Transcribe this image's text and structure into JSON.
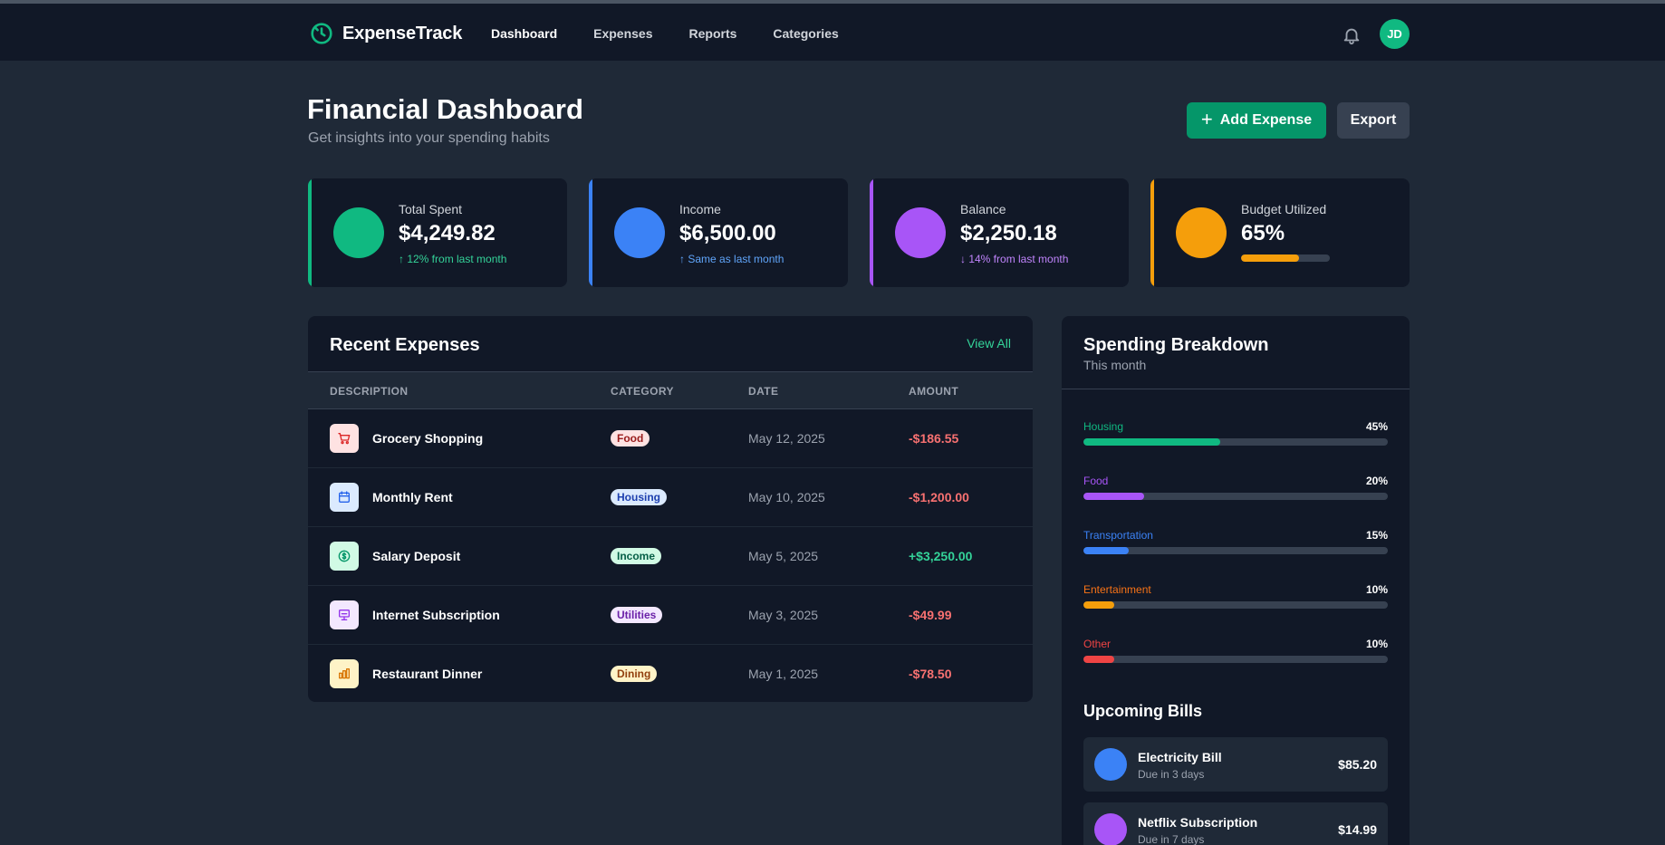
{
  "nav": {
    "brand": "ExpenseTrack",
    "links": [
      "Dashboard",
      "Expenses",
      "Reports",
      "Categories"
    ],
    "active": "Dashboard",
    "avatar_initials": "JD"
  },
  "header": {
    "title": "Financial Dashboard",
    "subtitle": "Get insights into your spending habits",
    "add_label": "Add Expense",
    "export_label": "Export"
  },
  "stats": [
    {
      "label": "Total Spent",
      "value": "$4,249.82",
      "change": "↑ 12% from last month",
      "color": "#10b981",
      "change_color": "#34d399"
    },
    {
      "label": "Income",
      "value": "$6,500.00",
      "change": "↑ Same as last month",
      "color": "#3b82f6",
      "change_color": "#60a5fa"
    },
    {
      "label": "Balance",
      "value": "$2,250.18",
      "change": "↓ 14% from last month",
      "color": "#a855f7",
      "change_color": "#c084fc"
    },
    {
      "label": "Budget Utilized",
      "value": "65%",
      "progress": 0.65,
      "color": "#f59e0b"
    }
  ],
  "recent": {
    "title": "Recent Expenses",
    "view_all": "View All",
    "columns": [
      "DESCRIPTION",
      "CATEGORY",
      "DATE",
      "AMOUNT"
    ],
    "rows": [
      {
        "description": "Grocery Shopping",
        "category": "Food",
        "date": "May 12, 2025",
        "amount": "-$186.55",
        "icon": "cart-icon",
        "icon_bg": "#fee2e2",
        "icon_color": "#dc2626",
        "badge_bg": "#fee2e2",
        "badge_color": "#991b1b",
        "amount_color": "#f87171"
      },
      {
        "description": "Monthly Rent",
        "category": "Housing",
        "date": "May 10, 2025",
        "amount": "-$1,200.00",
        "icon": "calendar-icon",
        "icon_bg": "#dbeafe",
        "icon_color": "#2563eb",
        "badge_bg": "#dbeafe",
        "badge_color": "#1e40af",
        "amount_color": "#f87171"
      },
      {
        "description": "Salary Deposit",
        "category": "Income",
        "date": "May 5, 2025",
        "amount": "+$3,250.00",
        "icon": "dollar-icon",
        "icon_bg": "#d1fae5",
        "icon_color": "#059669",
        "badge_bg": "#d1fae5",
        "badge_color": "#065f46",
        "amount_color": "#34d399"
      },
      {
        "description": "Internet Subscription",
        "category": "Utilities",
        "date": "May 3, 2025",
        "amount": "-$49.99",
        "icon": "monitor-icon",
        "icon_bg": "#f3e8ff",
        "icon_color": "#9333ea",
        "badge_bg": "#f3e8ff",
        "badge_color": "#6b21a8",
        "amount_color": "#f87171"
      },
      {
        "description": "Restaurant Dinner",
        "category": "Dining",
        "date": "May 1, 2025",
        "amount": "-$78.50",
        "icon": "chart-icon",
        "icon_bg": "#fef3c7",
        "icon_color": "#d97706",
        "badge_bg": "#fef3c7",
        "badge_color": "#92400e",
        "amount_color": "#f87171"
      }
    ]
  },
  "breakdown": {
    "title": "Spending Breakdown",
    "subtitle": "This month",
    "items": [
      {
        "name": "Housing",
        "pct": "45%",
        "value": 0.45,
        "color": "#10b981"
      },
      {
        "name": "Food",
        "pct": "20%",
        "value": 0.2,
        "color": "#a855f7"
      },
      {
        "name": "Transportation",
        "pct": "15%",
        "value": 0.15,
        "color": "#3b82f6"
      },
      {
        "name": "Entertainment",
        "pct": "10%",
        "value": 0.1,
        "color": "#f59e0b"
      },
      {
        "name": "Other",
        "pct": "10%",
        "value": 0.1,
        "color": "#ef4444"
      }
    ]
  },
  "bills": {
    "title": "Upcoming Bills",
    "items": [
      {
        "name": "Electricity Bill",
        "due": "Due in 3 days",
        "amount": "$85.20",
        "color": "#3b82f6"
      },
      {
        "name": "Netflix Subscription",
        "due": "Due in 7 days",
        "amount": "$14.99",
        "color": "#a855f7"
      }
    ]
  }
}
